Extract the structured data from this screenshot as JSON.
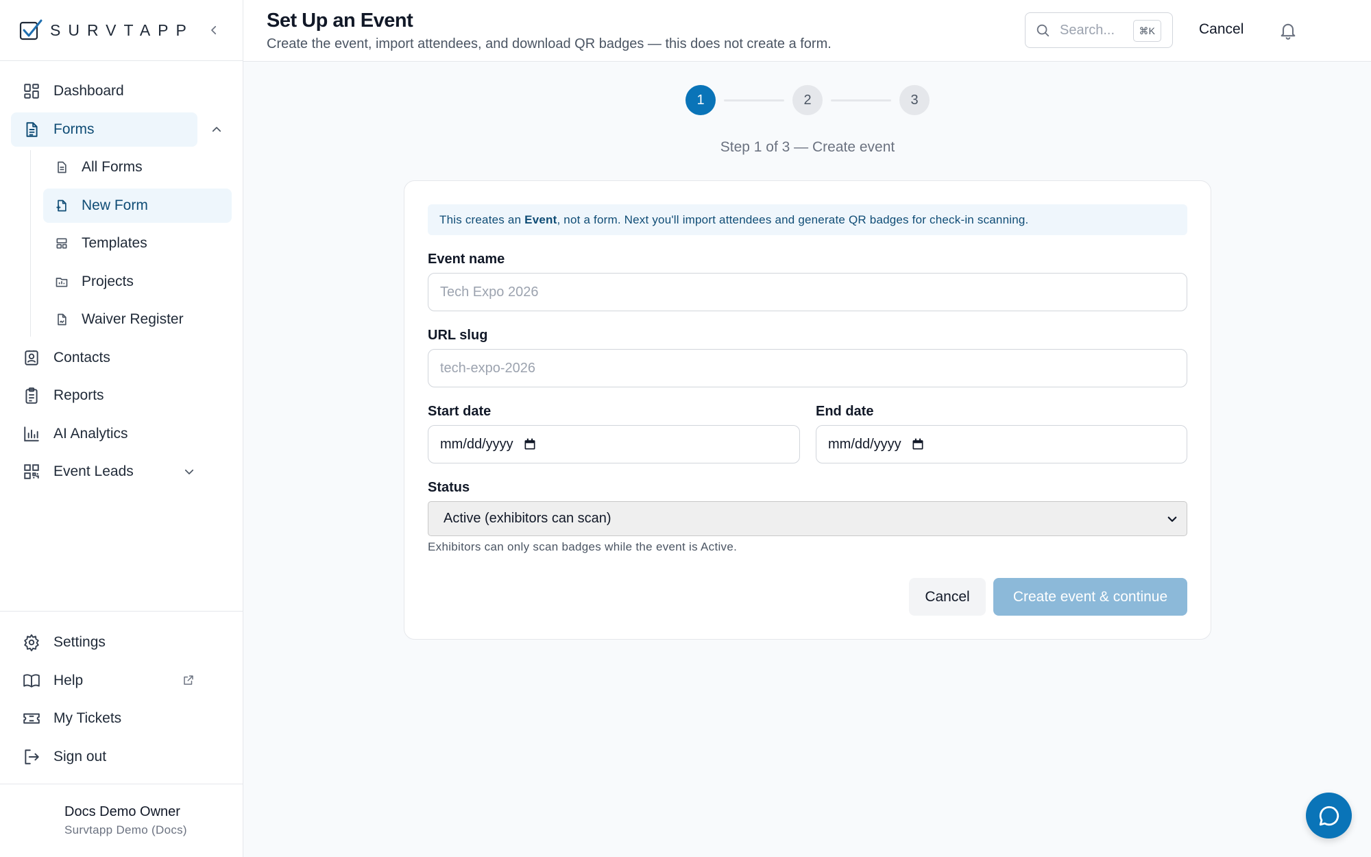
{
  "app": {
    "logo_text": "SURVTAPP"
  },
  "sidebar": {
    "items": [
      {
        "label": "Dashboard",
        "icon": "dashboard-icon"
      },
      {
        "label": "Forms",
        "icon": "form-icon",
        "active": true,
        "expanded": true
      },
      {
        "label": "Contacts",
        "icon": "contact-icon"
      },
      {
        "label": "Reports",
        "icon": "clipboard-icon"
      },
      {
        "label": "AI Analytics",
        "icon": "bar-chart-icon"
      },
      {
        "label": "Event Leads",
        "icon": "qr-code-icon",
        "expanded": false
      }
    ],
    "forms_subitems": [
      {
        "label": "All Forms",
        "icon": "document-icon"
      },
      {
        "label": "New Form",
        "icon": "new-document-icon",
        "active": true
      },
      {
        "label": "Templates",
        "icon": "template-icon"
      },
      {
        "label": "Projects",
        "icon": "folder-icon"
      },
      {
        "label": "Waiver Register",
        "icon": "signed-document-icon"
      }
    ],
    "bottom_items": [
      {
        "label": "Settings",
        "icon": "gear-icon"
      },
      {
        "label": "Help",
        "icon": "book-icon",
        "external": true
      },
      {
        "label": "My Tickets",
        "icon": "ticket-icon"
      },
      {
        "label": "Sign out",
        "icon": "sign-out-icon"
      }
    ],
    "profile": {
      "name": "Docs Demo Owner",
      "org": "Survtapp Demo (Docs)"
    }
  },
  "header": {
    "title": "Set Up an Event",
    "subtitle": "Create the event, import attendees, and download QR badges — this does not create a form.",
    "search_placeholder": "Search...",
    "search_shortcut": "⌘K",
    "cancel_label": "Cancel"
  },
  "stepper": {
    "steps": [
      "1",
      "2",
      "3"
    ],
    "current_step": 1,
    "caption": "Step 1 of 3 — Create event"
  },
  "form": {
    "banner_prefix": "This creates an ",
    "banner_bold": "Event",
    "banner_suffix": ", not a form. Next you'll import attendees and generate QR badges for check-in scanning.",
    "event_name_label": "Event name",
    "event_name_placeholder": "Tech Expo 2026",
    "event_name_value": "",
    "url_slug_label": "URL slug",
    "url_slug_placeholder": "tech-expo-2026",
    "url_slug_value": "",
    "start_date_label": "Start date",
    "start_date_value": "mm/dd/yyyy",
    "end_date_label": "End date",
    "end_date_value": "mm/dd/yyyy",
    "status_label": "Status",
    "status_value": "Active (exhibitors can scan)",
    "status_helper": "Exhibitors can only scan badges while the event is Active.",
    "cancel_label": "Cancel",
    "submit_label": "Create event & continue"
  },
  "colors": {
    "accent": "#0a74b8",
    "active_bg": "#eef6fc",
    "active_text": "#0f4c75",
    "disabled_primary": "#8cb9d9"
  }
}
